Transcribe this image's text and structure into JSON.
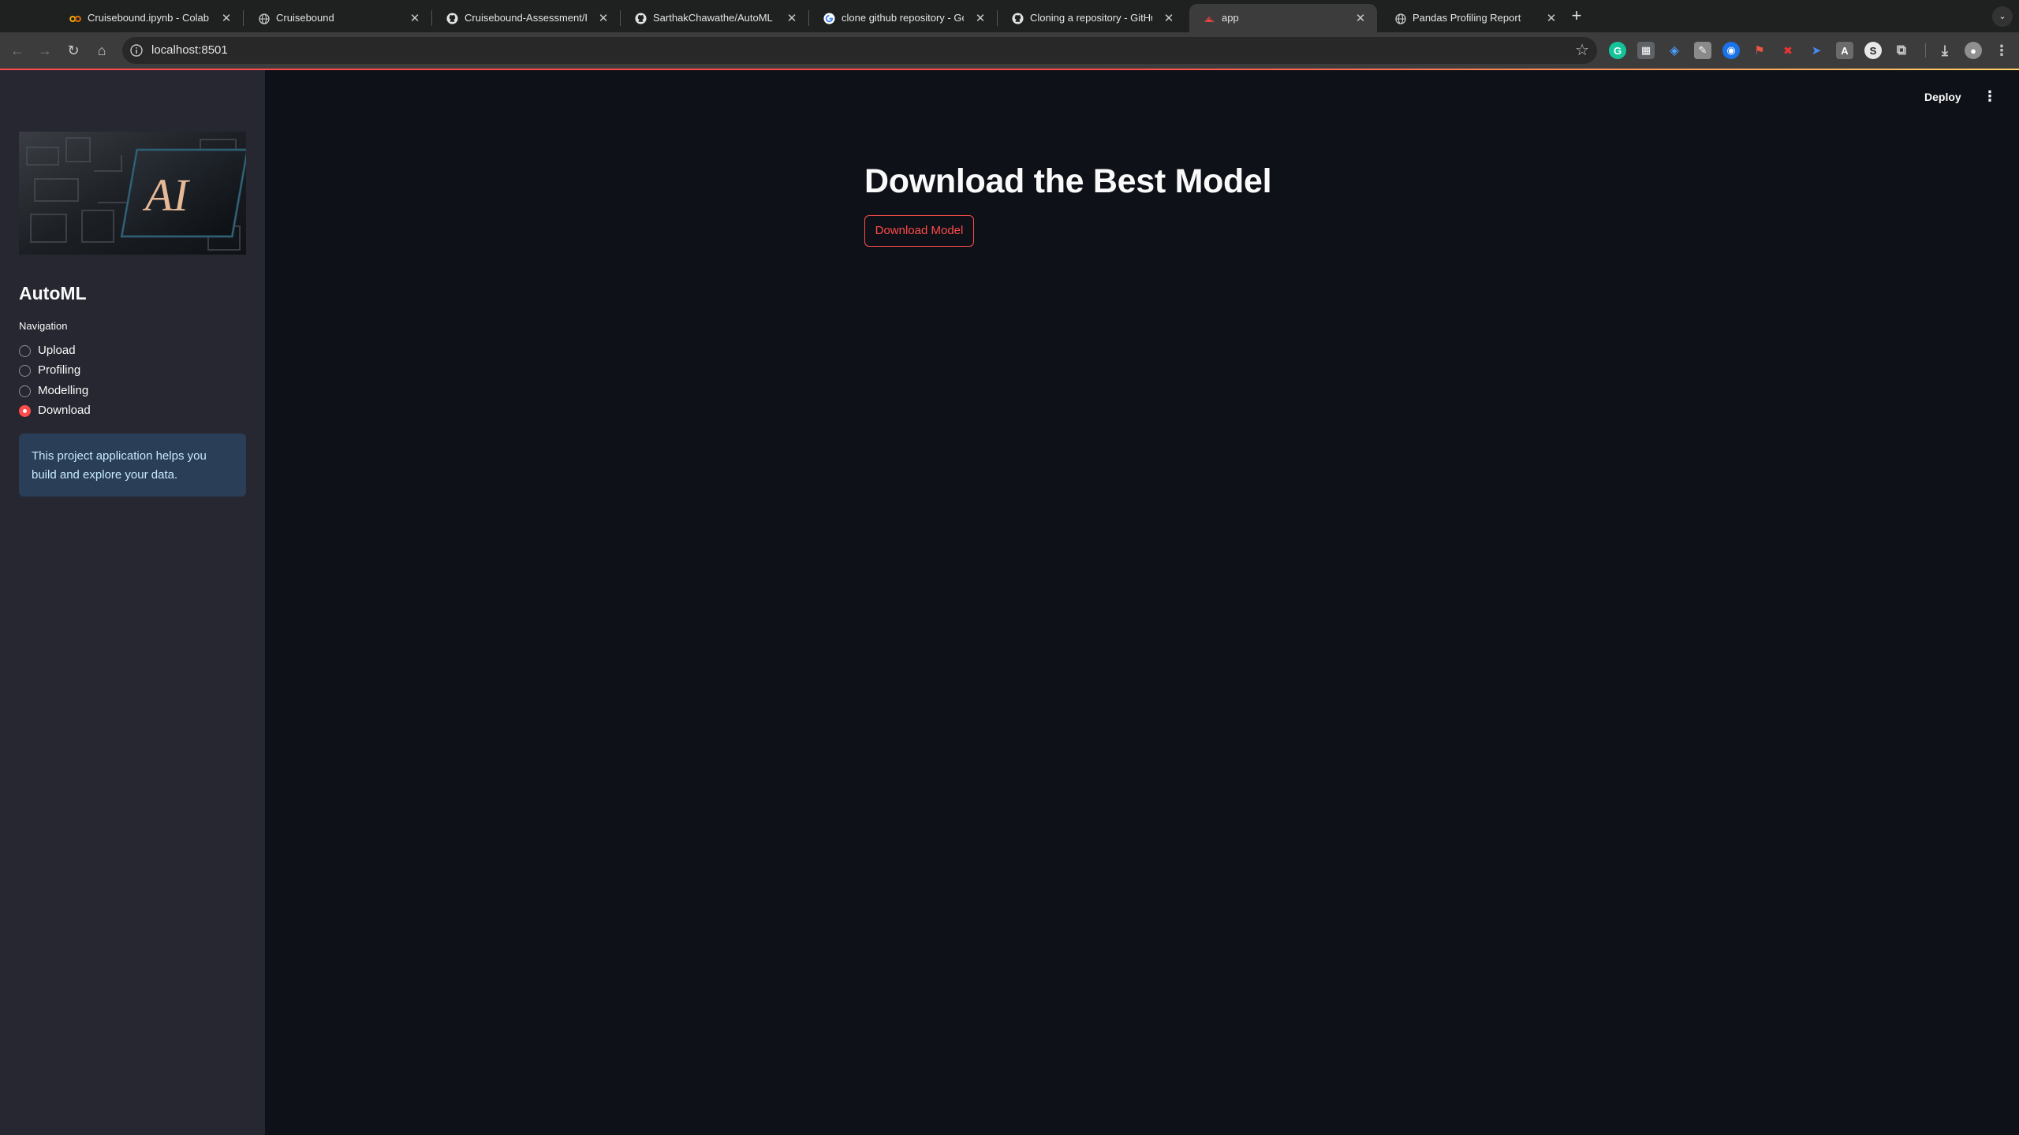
{
  "browser": {
    "tabs": [
      {
        "title": "Cruisebound.ipynb - Colab",
        "favicon": "colab-icon",
        "active": false
      },
      {
        "title": "Cruisebound",
        "favicon": "globe-icon",
        "active": false
      },
      {
        "title": "Cruisebound-Assessment/Pa",
        "favicon": "github-icon",
        "active": false
      },
      {
        "title": "SarthakChawathe/AutoML",
        "favicon": "github-icon",
        "active": false
      },
      {
        "title": "clone github repository - Goo",
        "favicon": "google-icon",
        "active": false
      },
      {
        "title": "Cloning a repository - GitHub",
        "favicon": "github-icon",
        "active": false
      },
      {
        "title": "app",
        "favicon": "streamlit-icon",
        "active": true
      },
      {
        "title": "Pandas Profiling Report",
        "favicon": "globe-icon",
        "active": false
      }
    ],
    "new_tab_symbol": "+",
    "address": "localhost:8501"
  },
  "sidebar": {
    "hero_text": "AI",
    "app_title": "AutoML",
    "nav_label": "Navigation",
    "nav_options": [
      {
        "label": "Upload",
        "selected": false
      },
      {
        "label": "Profiling",
        "selected": false
      },
      {
        "label": "Modelling",
        "selected": false
      },
      {
        "label": "Download",
        "selected": true
      }
    ],
    "info_text": "This project application helps you build and explore your data."
  },
  "header": {
    "deploy_label": "Deploy",
    "menu_symbol": "⋮"
  },
  "main": {
    "heading": "Download the Best Model",
    "download_button_label": "Download Model"
  },
  "colors": {
    "accent": "#ff4b4b",
    "background": "#0e1117",
    "sidebar": "#262730",
    "text": "#fafafa",
    "info_bg": "#1c2c40",
    "info_text": "#c7ebff"
  }
}
